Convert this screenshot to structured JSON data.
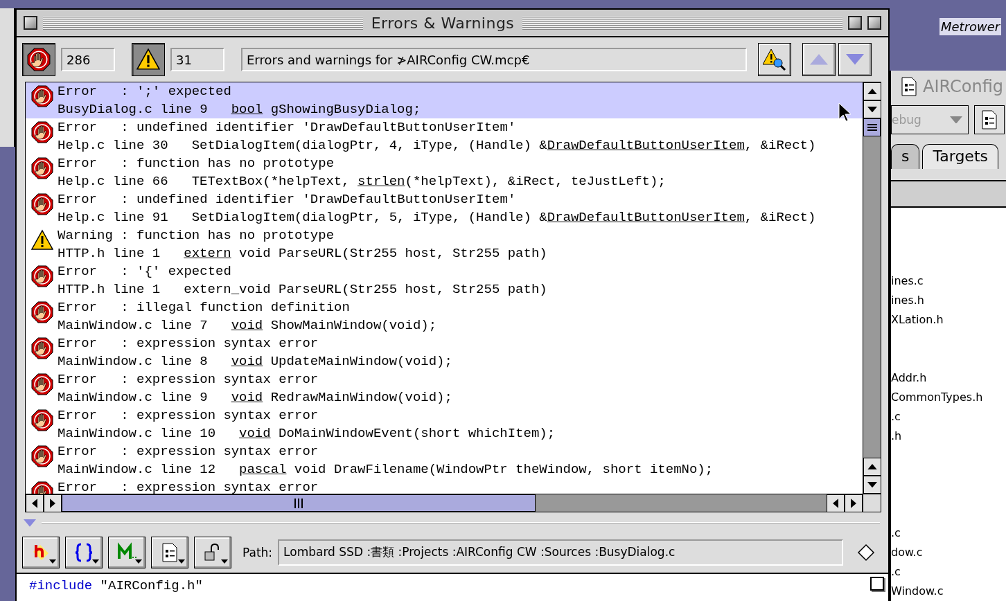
{
  "window": {
    "title": "Errors & Warnings"
  },
  "toolbar": {
    "errors_on": true,
    "errors_count": "286",
    "warnings_on": true,
    "warnings_count": "31",
    "description": "Errors and warnings for ≯AIRConfig CW.mcp€"
  },
  "messages": [
    {
      "kind": "error",
      "selected": true,
      "summary": "Error   : ';' expected",
      "location": "BusyDialog.c line 9",
      "code": [
        {
          "text": "bool",
          "underlined": true
        },
        {
          "text": " gShowingBusyDialog;",
          "underlined": false
        }
      ]
    },
    {
      "kind": "error",
      "selected": false,
      "summary": "Error   : undefined identifier 'DrawDefaultButtonUserItem'",
      "location": "Help.c line 30",
      "code": [
        {
          "text": "SetDialogItem(dialogPtr, 4, iType, (Handle) &",
          "underlined": false
        },
        {
          "text": "DrawDefaultButtonUserItem",
          "underlined": true
        },
        {
          "text": ", &iRect)",
          "underlined": false
        }
      ]
    },
    {
      "kind": "error",
      "selected": false,
      "summary": "Error   : function has no prototype",
      "location": "Help.c line 66",
      "code": [
        {
          "text": "TETextBox(*helpText, ",
          "underlined": false
        },
        {
          "text": "strlen",
          "underlined": true
        },
        {
          "text": "(*helpText), &iRect, teJustLeft);",
          "underlined": false
        }
      ]
    },
    {
      "kind": "error",
      "selected": false,
      "summary": "Error   : undefined identifier 'DrawDefaultButtonUserItem'",
      "location": "Help.c line 91",
      "code": [
        {
          "text": "SetDialogItem(dialogPtr, 5, iType, (Handle) &",
          "underlined": false
        },
        {
          "text": "DrawDefaultButtonUserItem",
          "underlined": true
        },
        {
          "text": ", &iRect)",
          "underlined": false
        }
      ]
    },
    {
      "kind": "warning",
      "selected": false,
      "summary": "Warning : function has no prototype",
      "location": "HTTP.h line 1",
      "code": [
        {
          "text": "extern",
          "underlined": true
        },
        {
          "text": " void ParseURL(Str255 host, Str255 path)",
          "underlined": false
        }
      ]
    },
    {
      "kind": "error",
      "selected": false,
      "summary": "Error   : '{' expected",
      "location": "HTTP.h line 1",
      "code": [
        {
          "text": "extern_void ParseURL(Str255 host, Str255 path)",
          "underlined": false
        }
      ]
    },
    {
      "kind": "error",
      "selected": false,
      "summary": "Error   : illegal function definition",
      "location": "MainWindow.c line 7",
      "code": [
        {
          "text": "void",
          "underlined": true
        },
        {
          "text": " ShowMainWindow(void);",
          "underlined": false
        }
      ]
    },
    {
      "kind": "error",
      "selected": false,
      "summary": "Error   : expression syntax error",
      "location": "MainWindow.c line 8",
      "code": [
        {
          "text": "void",
          "underlined": true
        },
        {
          "text": " UpdateMainWindow(void);",
          "underlined": false
        }
      ]
    },
    {
      "kind": "error",
      "selected": false,
      "summary": "Error   : expression syntax error",
      "location": "MainWindow.c line 9",
      "code": [
        {
          "text": "void",
          "underlined": true
        },
        {
          "text": " RedrawMainWindow(void);",
          "underlined": false
        }
      ]
    },
    {
      "kind": "error",
      "selected": false,
      "summary": "Error   : expression syntax error",
      "location": "MainWindow.c line 10",
      "code": [
        {
          "text": "void",
          "underlined": true
        },
        {
          "text": " DoMainWindowEvent(short whichItem);",
          "underlined": false
        }
      ]
    },
    {
      "kind": "error",
      "selected": false,
      "summary": "Error   : expression syntax error",
      "location": "MainWindow.c line 12",
      "code": [
        {
          "text": "pascal",
          "underlined": true
        },
        {
          "text": " void DrawFilename(WindowPtr theWindow, short itemNo);",
          "underlined": false
        }
      ]
    },
    {
      "kind": "error",
      "selected": false,
      "summary": "Error   : expression syntax error"
    }
  ],
  "path_bar": {
    "label": "Path:",
    "path": "Lombard SSD :書類 :Projects :AIRConfig CW :Sources :BusyDialog.c"
  },
  "editor": {
    "lines": [
      [
        {
          "text": "#include",
          "kind": "directive"
        },
        {
          "text": " \"AIRConfig.h\"",
          "kind": "plain"
        }
      ]
    ]
  },
  "desktop_label": "Metrower",
  "project_window": {
    "title": "AIRConfig",
    "target_popup": "ebug",
    "tabs": [
      {
        "label": "s",
        "selected": false
      },
      {
        "label": "Targets",
        "selected": true
      }
    ],
    "file_groups": [
      [
        "ines.c",
        "ines.h",
        "XLation.h"
      ],
      [
        "Addr.h",
        "CommonTypes.h",
        ".c",
        ".h"
      ],
      [
        ".c",
        "dow.c",
        ".c",
        "Window.c"
      ]
    ]
  }
}
